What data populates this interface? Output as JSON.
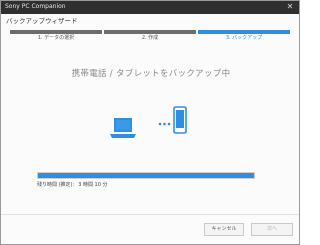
{
  "app": {
    "title": "Sony PC Companion",
    "close_symbol": "✕"
  },
  "wizard": {
    "title": "バックアップウィザード"
  },
  "steps": [
    {
      "label": "1. データの選択",
      "state": "done"
    },
    {
      "label": "2. 作成",
      "state": "done"
    },
    {
      "label": "3. バックアップ",
      "state": "active"
    }
  ],
  "main": {
    "heading": "携帯電話 / タブレットをバックアップ中",
    "progress_fraction": 1.0,
    "remaining_label": "残り時間 (推定):",
    "remaining_value": "3 時間 10 分"
  },
  "buttons": {
    "cancel": "キャンセル",
    "next": "次へ"
  },
  "colors": {
    "accent": "#2f8ee0",
    "titlebar": "#2f2f2f",
    "inactive_step": "#6d6d6d"
  },
  "icons": {
    "laptop": "laptop-icon",
    "phone": "phone-icon",
    "transfer": "transfer-dots-icon"
  }
}
